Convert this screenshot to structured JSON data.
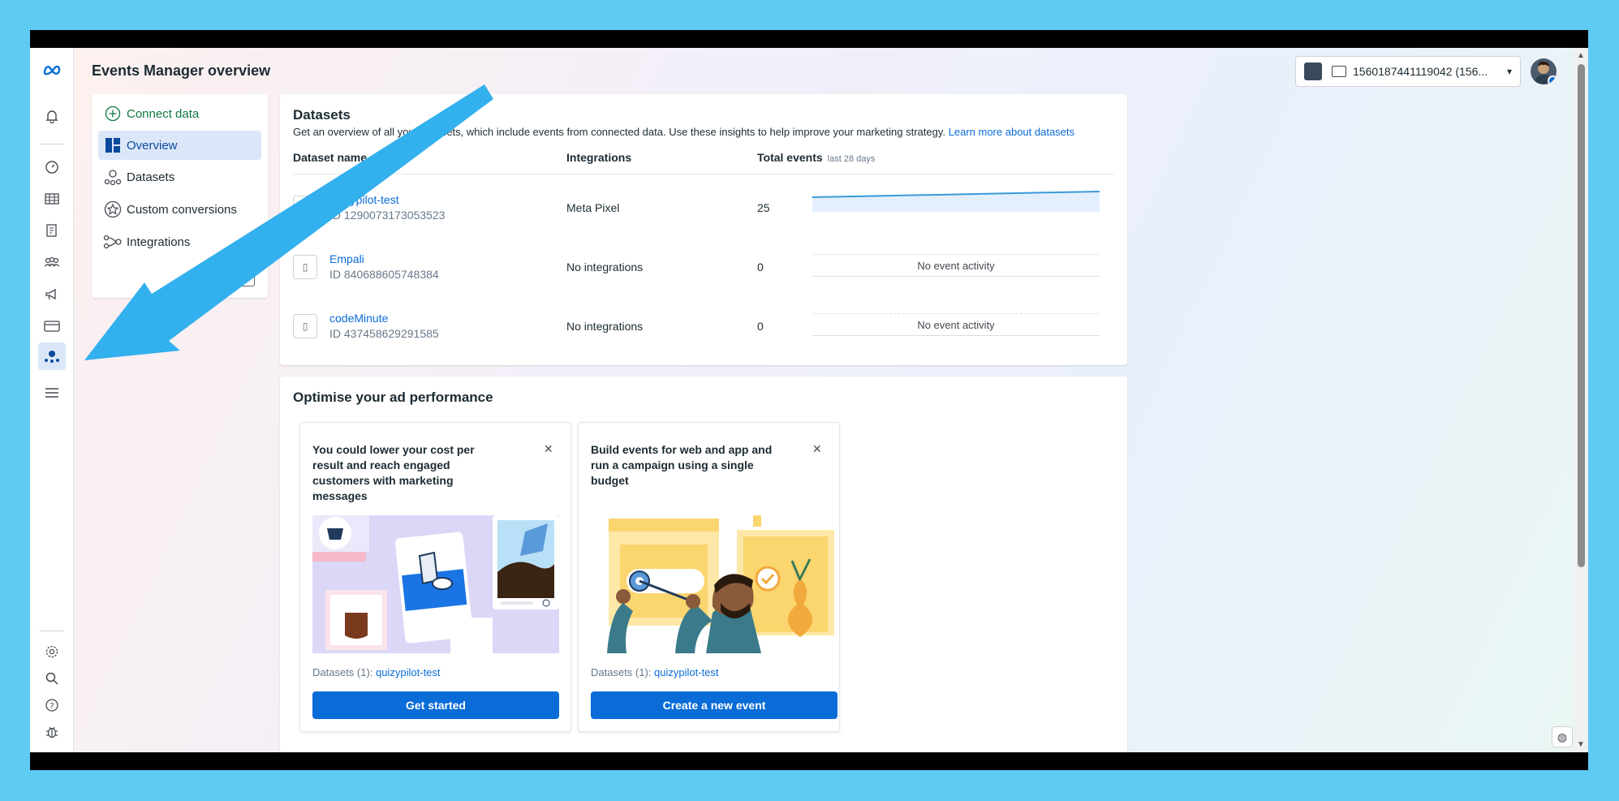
{
  "page": {
    "title": "Events Manager overview"
  },
  "brand": {
    "logo": "∞",
    "accent": "#0a6cd6"
  },
  "account": {
    "label": "1560187441119042 (156...",
    "caret": "▾"
  },
  "subnav": {
    "connect": "Connect data",
    "items": [
      {
        "label": "Overview",
        "icon": "overview-icon"
      },
      {
        "label": "Datasets",
        "icon": "datasets-icon"
      },
      {
        "label": "Custom conversions",
        "icon": "star-icon"
      },
      {
        "label": "Integrations",
        "icon": "integrations-icon"
      }
    ]
  },
  "datasets": {
    "title": "Datasets",
    "description": "Get an overview of all your datasets, which include events from connected data. Use these insights to help improve your marketing strategy.",
    "learn_more": "Learn more about datasets",
    "columns": {
      "name": "Dataset name",
      "integrations": "Integrations",
      "total": "Total events",
      "period": "last 28 days"
    },
    "rows": [
      {
        "name": "quizypilot-test",
        "id": "ID 1290073173053523",
        "integration": "Meta Pixel",
        "count": "25",
        "activity": ""
      },
      {
        "name": "Empali",
        "id": "ID 840688605748384",
        "integration": "No integrations",
        "count": "0",
        "activity": "No event activity"
      },
      {
        "name": "codeMinute",
        "id": "ID 437458629291585",
        "integration": "No integrations",
        "count": "0",
        "activity": "No event activity"
      }
    ]
  },
  "optimise": {
    "title": "Optimise your ad performance",
    "cards": [
      {
        "title": "You could lower your cost per result and reach engaged customers with marketing messages",
        "meta_prefix": "Datasets (1):",
        "meta_link": "quizypilot-test",
        "button": "Get started",
        "close": "×"
      },
      {
        "title": "Build events for web and app and run a campaign using a single budget",
        "meta_prefix": "Datasets (1):",
        "meta_link": "quizypilot-test",
        "button": "Create a new event",
        "close": "×"
      }
    ]
  }
}
